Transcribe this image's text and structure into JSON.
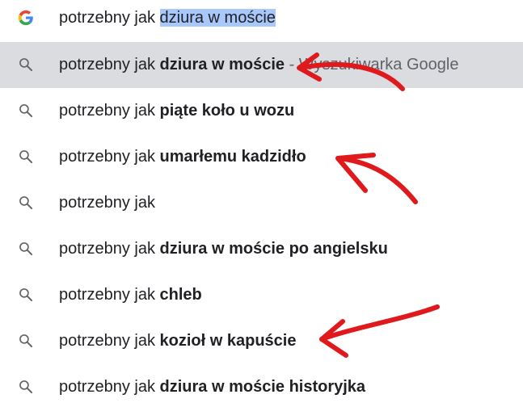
{
  "omnibox": {
    "typed_text": "potrzebny jak ",
    "selected_text": "dziura w moście"
  },
  "suggestions": [
    {
      "prefix": "potrzebny jak ",
      "bold": "dziura w moście",
      "suffix": " - Wyszukiwarka Google",
      "active": true
    },
    {
      "prefix": "potrzebny jak ",
      "bold": "piąte koło u wozu",
      "suffix": ""
    },
    {
      "prefix": "potrzebny jak ",
      "bold": "umarłemu kadzidło",
      "suffix": ""
    },
    {
      "prefix": "potrzebny jak",
      "bold": "",
      "suffix": ""
    },
    {
      "prefix": "potrzebny jak ",
      "bold": "dziura w moście po angielsku",
      "suffix": ""
    },
    {
      "prefix": "potrzebny jak ",
      "bold": "chleb",
      "suffix": ""
    },
    {
      "prefix": "potrzebny jak ",
      "bold": "kozioł w kapuście",
      "suffix": ""
    },
    {
      "prefix": "potrzebny jak ",
      "bold": "dziura w moście historyjka",
      "suffix": ""
    }
  ],
  "colors": {
    "active_row": "#dadce0",
    "selection": "#a8c7fa",
    "annotation_red": "#e0191d",
    "icon_gray": "#5f6368"
  }
}
